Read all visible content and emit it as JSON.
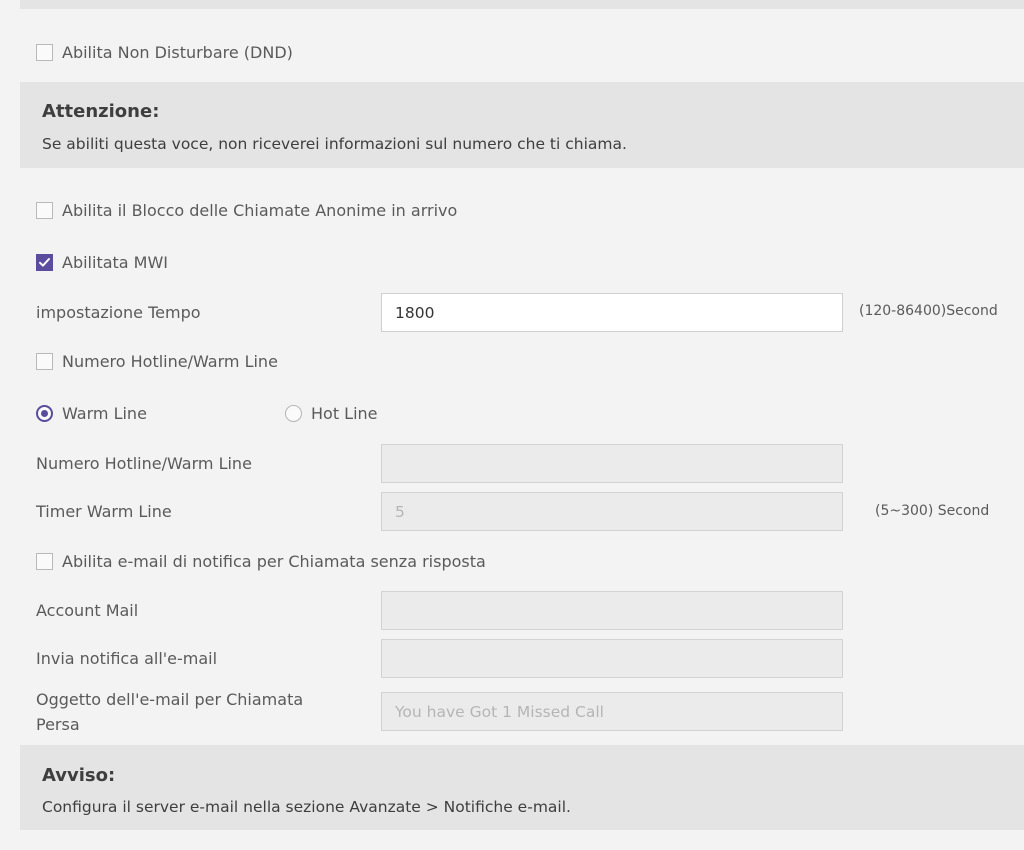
{
  "dnd": {
    "label": "Abilita Non Disturbare (DND)",
    "checked": false
  },
  "attention": {
    "title": "Attenzione:",
    "body": "Se abiliti questa voce, non riceverei informazioni sul numero che ti chiama."
  },
  "anon_block": {
    "label": "Abilita il Blocco delle Chiamate Anonime in arrivo",
    "checked": false
  },
  "mwi": {
    "label": "Abilitata MWI",
    "checked": true
  },
  "time_setting": {
    "label": "impostazione Tempo",
    "value": "1800",
    "hint": "(120-86400)Second"
  },
  "hotline_enable": {
    "label": "Numero Hotline/Warm Line",
    "checked": false
  },
  "line_type": {
    "options": [
      {
        "label": "Warm Line",
        "selected": true
      },
      {
        "label": "Hot Line",
        "selected": false
      }
    ]
  },
  "hotline_number": {
    "label": "Numero Hotline/Warm Line",
    "value": ""
  },
  "warm_timer": {
    "label": "Timer Warm Line",
    "placeholder": "5",
    "hint": "(5~300) Second"
  },
  "missed_email": {
    "label": "Abilita e-mail di notifica per Chiamata senza risposta",
    "checked": false
  },
  "mail_account": {
    "label": "Account Mail",
    "value": ""
  },
  "notify_email": {
    "label": "Invia notifica all'e-mail",
    "value": ""
  },
  "email_subject": {
    "label_line1": "Oggetto dell'e-mail per Chiamata",
    "label_line2": "Persa",
    "placeholder": "You have Got 1 Missed Call"
  },
  "warning": {
    "title": "Avviso:",
    "body": "Configura il server e-mail nella sezione Avanzate > Notifiche e-mail."
  },
  "colors": {
    "accent": "#5b4c9e",
    "panel": "#e4e4e4",
    "background": "#f3f3f3"
  }
}
